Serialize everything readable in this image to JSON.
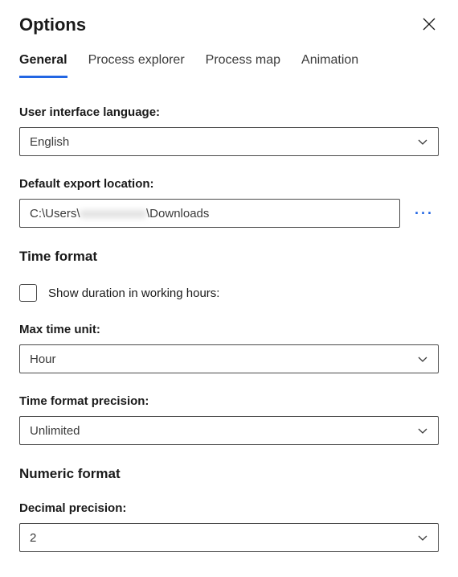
{
  "header": {
    "title": "Options"
  },
  "tabs": [
    {
      "label": "General",
      "active": true
    },
    {
      "label": "Process explorer",
      "active": false
    },
    {
      "label": "Process map",
      "active": false
    },
    {
      "label": "Animation",
      "active": false
    }
  ],
  "fields": {
    "ui_language": {
      "label": "User interface language:",
      "value": "English"
    },
    "export_location": {
      "label": "Default export location:",
      "prefix": "C:\\Users\\",
      "redacted": "xxxxxxxxxxx",
      "suffix": "\\Downloads"
    }
  },
  "time_format": {
    "section_label": "Time format",
    "show_working_hours": {
      "label": "Show duration in working hours:",
      "checked": false
    },
    "max_unit": {
      "label": "Max time unit:",
      "value": "Hour"
    },
    "precision": {
      "label": "Time format precision:",
      "value": "Unlimited"
    }
  },
  "numeric_format": {
    "section_label": "Numeric format",
    "decimal_precision": {
      "label": "Decimal precision:",
      "value": "2"
    }
  }
}
